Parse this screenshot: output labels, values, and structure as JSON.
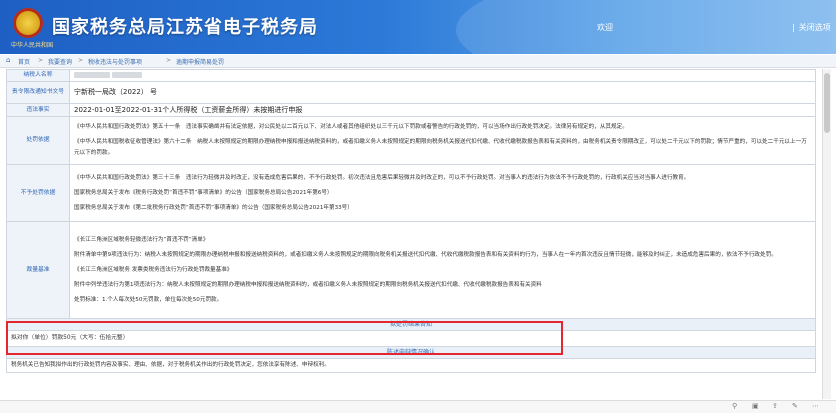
{
  "header": {
    "emblem_motto": "中华人民共和国",
    "title": "国家税务总局江苏省电子税务局",
    "welcome": "欢迎",
    "close_label": "关闭选项"
  },
  "breadcrumb": {
    "items": [
      "首页",
      "我要查询",
      "税收违法与处罚事项",
      "逾期申报简易处罚"
    ],
    "separator": ">"
  },
  "rows": {
    "taxpayer_name_label": "纳税人名称",
    "notice_label": "责令限改通知书文号",
    "notice_value": "宁新税一局改（2022）        号",
    "violation_label": "违法事实",
    "violation_value": "2022-01-01至2022-01-31个人所得税（工资薪金所得）未按期进行申报",
    "penalty_basis_label": "处罚依据",
    "penalty_basis_p1": "《中华人民共和国行政处罚法》第五十一条　违法事实确凿并有法定依据，对公民处以二百元以下、对法人或者其他组织处以三千元以下罚款或者警告的行政处罚的，可以当场作出行政处罚决定。法律另有规定的，从其规定。",
    "penalty_basis_p2": "《中华人民共和国税收征收管理法》第六十二条　纳税人未按照规定的期限办理纳税申报和报送纳税资料的，或者扣缴义务人未按照规定的期限向税务机关报送代扣代缴、代收代缴税款报告表和有关资料的，由税务机关责令限期改正，可以处二千元以下的罚款；情节严重的，可以处二千元以上一万元以下的罚款。",
    "no_penalty_label": "不予处罚依据",
    "no_penalty_p1": "《中华人民共和国行政处罚法》第三十三条　违法行为轻微并及时改正，没有造成危害后果的，不予行政处罚。初次违法且危害后果轻微并及时改正的，可以不予行政处罚。对当事人的违法行为依法不予行政处罚的，行政机关应当对当事人进行教育。",
    "no_penalty_p2": "国家税务总局关于发布《税务行政处罚“首违不罚”事项清单》的公告（国家税务总局公告2021年第6号）",
    "no_penalty_p3": "国家税务总局关于发布《第二批税务行政处罚“首违不罚”事项清单》的公告（国家税务总局公告2021年第33号）",
    "criteria_label": "裁量基准",
    "criteria_p1": "《长江三角洲区域税务轻微违法行为“首违不罚”清单》",
    "criteria_p2": "附件清单中第9项违法行为：纳税人未按照规定的期限办理纳税申报和报送纳税资料的，或者扣缴义务人未按照规定的期限向税务机关报送代扣代缴、代收代缴税款报告表和有关资料的行为，当事人在一年内首次违反且情节轻微，能够及时纠正，未造成危害后果的，依法不予行政处罚。",
    "criteria_p3": "《长江三角洲区域税务 发票类税务违法行为行政处罚裁量基准》",
    "criteria_p4": "附件中列举违法行为第1项违法行为：纳税人未按照规定的期限办理纳税申报和报送纳税资料的，或者扣缴义务人未按照规定的期限向税务机关报送代扣代缴、代收代缴税款报告表和有关资料",
    "criteria_p5": "处罚标准：1.个人每次处50元罚款，单位每次处50元罚款。",
    "penalty_result_header": "拟处罚结果告知",
    "penalty_result_value": "拟对你（单位）罚款50元（大写：伍拾元整）",
    "statement_header": "陈述申辩情况确认",
    "statement_text": "税务机关已告知我拟作出的行政处罚内容及事实、理由、依据，对于税务机关作出的行政处罚决定，您依法享有陈述、申辩权利。"
  },
  "bottom_icons": [
    "pin-icon",
    "image-icon",
    "share-icon",
    "edit-icon",
    "more-icon"
  ]
}
